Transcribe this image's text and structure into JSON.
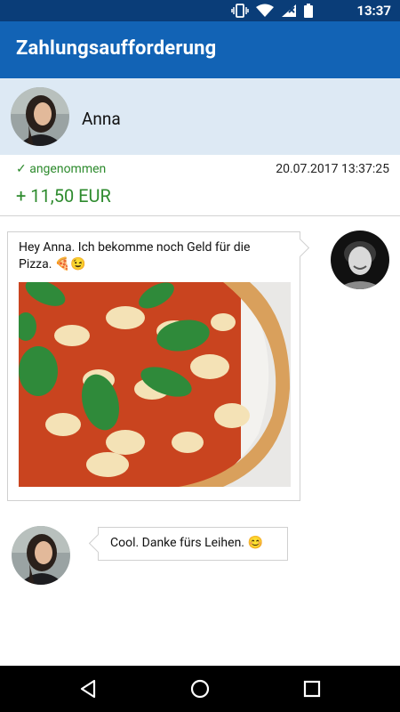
{
  "status_bar": {
    "time": "13:37"
  },
  "app_bar": {
    "title": "Zahlungsaufforderung"
  },
  "contact": {
    "name": "Anna"
  },
  "transaction": {
    "status": "✓ angenommen",
    "datetime": "20.07.2017 13:37:25",
    "amount": "+ 11,50 EUR"
  },
  "messages": {
    "outgoing_text": "Hey Anna. Ich bekomme noch Geld für die Pizza. 🍕😉",
    "incoming_text": "Cool. Danke fürs Leihen. 😊"
  },
  "nav": {
    "icons": [
      "back-icon",
      "home-icon",
      "recents-icon"
    ]
  },
  "colors": {
    "app_bar": "#1263b5",
    "status_bar": "#0a3d78",
    "contact_bg": "#dde9f4",
    "accepted_green": "#2e8b2e"
  }
}
